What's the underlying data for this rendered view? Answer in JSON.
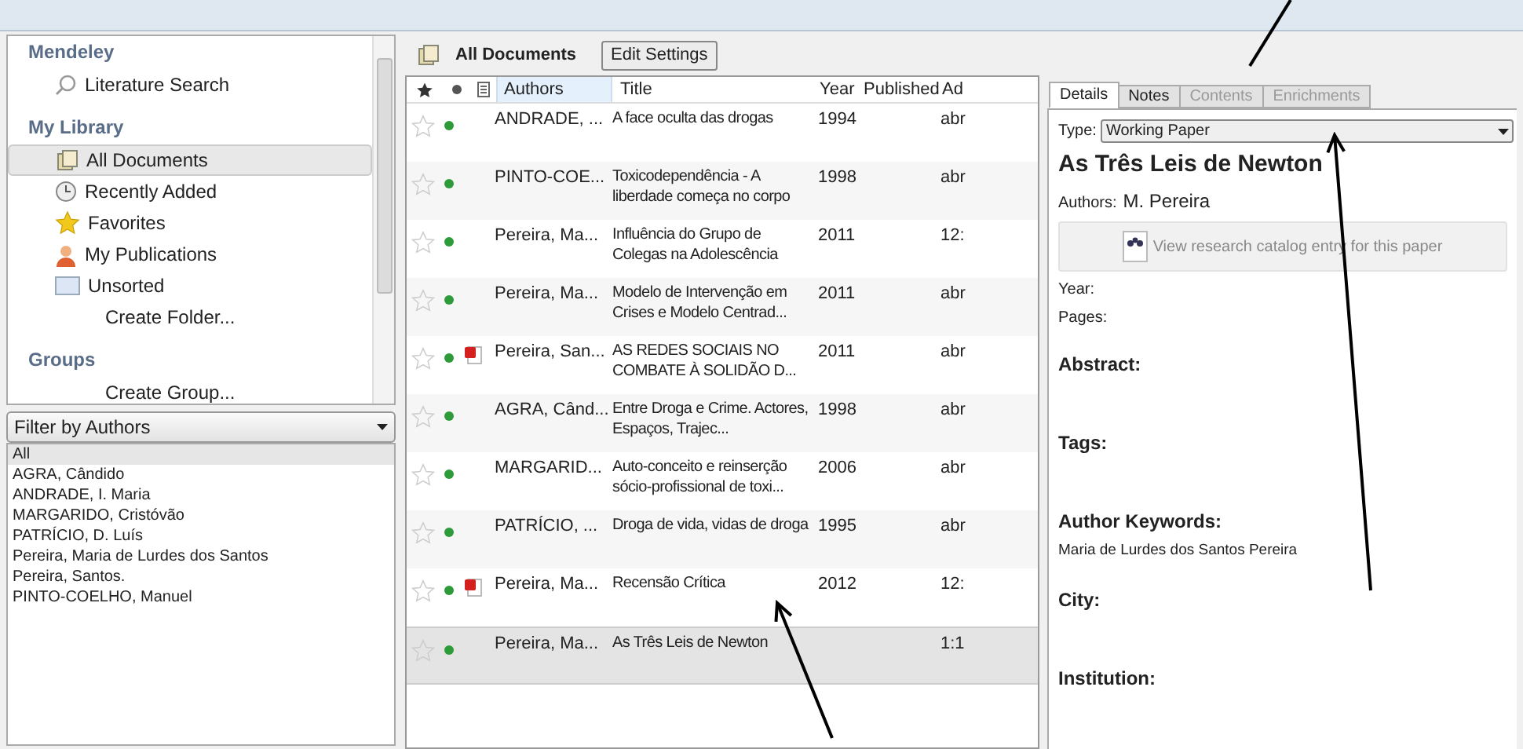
{
  "sidebar": {
    "sections": [
      {
        "title": "Mendeley",
        "items": [
          {
            "label": "Literature Search",
            "kind": "search",
            "selected": false
          }
        ]
      },
      {
        "title": "My Library",
        "items": [
          {
            "label": "All Documents",
            "kind": "docs",
            "selected": true
          },
          {
            "label": "Recently Added",
            "kind": "clock",
            "selected": false
          },
          {
            "label": "Favorites",
            "kind": "star",
            "selected": false
          },
          {
            "label": "My Publications",
            "kind": "person",
            "selected": false
          },
          {
            "label": "Unsorted",
            "kind": "tray",
            "selected": false
          },
          {
            "label": "Create Folder...",
            "kind": "action",
            "selected": false
          }
        ]
      },
      {
        "title": "Groups",
        "items": [
          {
            "label": "Create Group...",
            "kind": "action",
            "selected": false
          }
        ]
      }
    ]
  },
  "filter": {
    "value": "Filter by Authors",
    "items": [
      {
        "label": "All",
        "selected": true
      },
      {
        "label": "AGRA, Cândido",
        "selected": false
      },
      {
        "label": "ANDRADE, I. Maria",
        "selected": false
      },
      {
        "label": "MARGARIDO, Cristóvão",
        "selected": false
      },
      {
        "label": "PATRÍCIO, D. Luís",
        "selected": false
      },
      {
        "label": "Pereira, Maria de Lurdes dos Santos",
        "selected": false
      },
      {
        "label": "Pereira, Santos.",
        "selected": false
      },
      {
        "label": "PINTO-COELHO, Manuel",
        "selected": false
      }
    ]
  },
  "toolbar": {
    "title": "All Documents",
    "button": "Edit Settings"
  },
  "table": {
    "columns": [
      "Authors",
      "Title",
      "Year",
      "Published",
      "Ad"
    ],
    "rows": [
      {
        "favorite": false,
        "unread": true,
        "pdf": false,
        "selected": false,
        "authors": "ANDRADE, ...",
        "title": "A face oculta das drogas",
        "year": "1994",
        "added": "abr"
      },
      {
        "favorite": false,
        "unread": true,
        "pdf": false,
        "selected": false,
        "authors": "PINTO-COE...",
        "title": "Toxicodependência - A liberdade começa no corpo",
        "year": "1998",
        "added": "abr"
      },
      {
        "favorite": false,
        "unread": true,
        "pdf": false,
        "selected": false,
        "authors": "Pereira, Ma...",
        "title": "Influência do Grupo de Colegas na Adolescência",
        "year": "2011",
        "added": "12:"
      },
      {
        "favorite": false,
        "unread": true,
        "pdf": false,
        "selected": false,
        "authors": "Pereira, Ma...",
        "title": "Modelo de Intervenção em Crises e Modelo Centrad...",
        "year": "2011",
        "added": "abr"
      },
      {
        "favorite": false,
        "unread": true,
        "pdf": true,
        "selected": false,
        "authors": "Pereira, San...",
        "title": "AS REDES SOCIAIS NO COMBATE À SOLIDÃO D...",
        "year": "2011",
        "added": "abr"
      },
      {
        "favorite": false,
        "unread": true,
        "pdf": false,
        "selected": false,
        "authors": "AGRA, Când...",
        "title": "Entre Droga e Crime. Actores, Espaços, Trajec...",
        "year": "1998",
        "added": "abr"
      },
      {
        "favorite": false,
        "unread": true,
        "pdf": false,
        "selected": false,
        "authors": "MARGARID...",
        "title": "Auto-conceito e reinserção sócio-profissional de toxi...",
        "year": "2006",
        "added": "abr"
      },
      {
        "favorite": false,
        "unread": true,
        "pdf": false,
        "selected": false,
        "authors": "PATRÍCIO, ...",
        "title": "Droga de vida, vidas de droga",
        "year": "1995",
        "added": "abr"
      },
      {
        "favorite": false,
        "unread": true,
        "pdf": true,
        "selected": false,
        "authors": "Pereira, Ma...",
        "title": "Recensão Crítica",
        "year": "2012",
        "added": "12:"
      },
      {
        "favorite": false,
        "unread": true,
        "pdf": false,
        "selected": true,
        "authors": "Pereira, Ma...",
        "title": "As Três Leis de Newton",
        "year": "",
        "added": "1:1"
      }
    ]
  },
  "details": {
    "tabs": [
      {
        "label": "Details",
        "selected": true,
        "disabled": false
      },
      {
        "label": "Notes",
        "selected": false,
        "disabled": false
      },
      {
        "label": "Contents",
        "selected": false,
        "disabled": true
      },
      {
        "label": "Enrichments",
        "selected": false,
        "disabled": true
      }
    ],
    "type_label": "Type:",
    "type_value": "Working Paper",
    "title": "As Três Leis de Newton",
    "authors_label": "Authors:",
    "authors": "M. Pereira",
    "catalog_button": "View research catalog entry for this paper",
    "fields": [
      {
        "kind": "small",
        "label": "Year:"
      },
      {
        "kind": "small",
        "label": "Pages:"
      },
      {
        "kind": "heading",
        "label": "Abstract:"
      },
      {
        "kind": "heading",
        "label": "Tags:"
      },
      {
        "kind": "heading",
        "label": "Author Keywords:",
        "value": "Maria de Lurdes dos Santos Pereira"
      },
      {
        "kind": "heading",
        "label": "City:"
      },
      {
        "kind": "heading",
        "label": "Institution:"
      }
    ]
  }
}
